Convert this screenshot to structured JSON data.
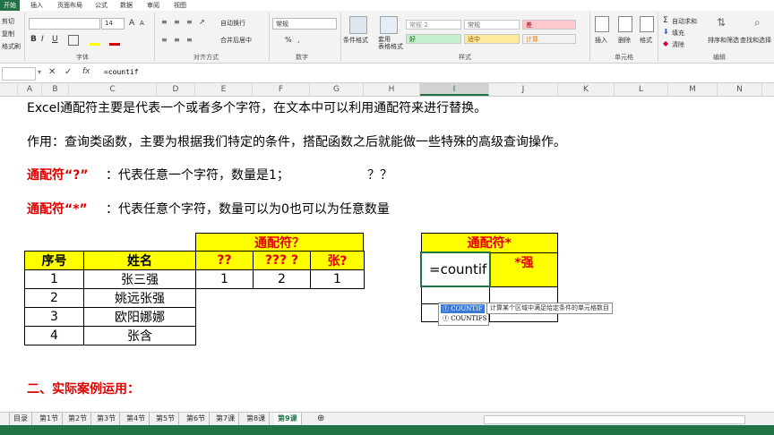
{
  "ribbon_tabs": [
    "开始",
    "插入",
    "页面布局",
    "公式",
    "数据",
    "审阅",
    "视图"
  ],
  "clipboard": {
    "cut": "剪切",
    "copy": "复制",
    "format_painter": "格式刷"
  },
  "font": {
    "size": "14",
    "label": "字体",
    "bold": "B",
    "italic": "I",
    "underline": "U"
  },
  "alignment": {
    "wrap": "自动换行",
    "merge": "合并后居中",
    "label": "对齐方式"
  },
  "number": {
    "format": "常规",
    "percent": "%",
    "comma": ",",
    "label": "数字"
  },
  "styles": {
    "conditional": "条件格式",
    "table_format": "套用\n表格格式",
    "cells": [
      "常规 2",
      "常规",
      "差",
      "好",
      "适中",
      "计算"
    ],
    "label": "样式"
  },
  "cells_group": {
    "insert": "插入",
    "delete": "删除",
    "format": "格式",
    "label": "单元格"
  },
  "editing": {
    "autosum": "自动求和",
    "fill": "填充",
    "clear": "清除",
    "sort": "排序和筛选",
    "find": "查找和选择",
    "label": "编辑"
  },
  "formula_bar": {
    "fx": "fx",
    "content": "=countif"
  },
  "columns": [
    "A",
    "B",
    "C",
    "D",
    "E",
    "F",
    "G",
    "H",
    "I",
    "J",
    "K",
    "L",
    "M",
    "N"
  ],
  "sheet": {
    "line1": "Excel通配符主要是代表一个或者多个字符，在文本中可以利用通配符来进行替换。",
    "line2": "作用：查询类函数，主要为根据我们特定的条件，搭配函数之后就能做一些特殊的高级查询操作。",
    "line3_label": "通配符“?”",
    "line3_text": "：代表任意一个字符，数量是1；",
    "line3_q": "？？",
    "line4_label": "通配符“*”",
    "line4_text": "：代表任意个字符，数量可以为0也可以为任意数量",
    "section": "二、实际案例运用："
  },
  "table1": {
    "header_merged": "通配符？",
    "headers": [
      "序号",
      "姓名",
      "??",
      "??? ?",
      "张?"
    ],
    "rows": [
      [
        "1",
        "张三强",
        "1",
        "2",
        "1"
      ],
      [
        "2",
        "姚远张强",
        "",
        "",
        ""
      ],
      [
        "3",
        "欧阳娜娜",
        "",
        "",
        ""
      ],
      [
        "4",
        "张含",
        "",
        "",
        ""
      ]
    ]
  },
  "table2": {
    "header_merged": "通配符*",
    "sub_header": "*强",
    "editing_cell": "=countif"
  },
  "autocomplete": {
    "items": [
      "COUNTIF",
      "COUNTIFS"
    ],
    "tooltip": "计算某个区域中满足给定条件的单元格数目"
  },
  "sheet_tabs": [
    "目录",
    "第1节",
    "第2节",
    "第3节",
    "第4节",
    "第5节",
    "第6节",
    "第7课",
    "第8课",
    "第9课"
  ],
  "active_sheet": "第9课"
}
